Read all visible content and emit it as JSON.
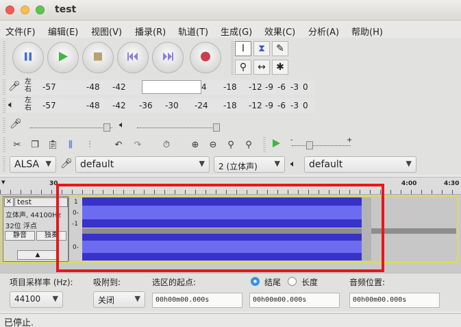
{
  "window": {
    "title": "test"
  },
  "menu": [
    "文件(F)",
    "编辑(E)",
    "视图(V)",
    "播录(R)",
    "轨道(T)",
    "生成(G)",
    "效果(C)",
    "分析(A)",
    "帮助(H)"
  ],
  "meters": {
    "record_channel_label": [
      "左",
      "右"
    ],
    "play_channel_label": [
      "左",
      "右"
    ],
    "record_ticks": [
      "-57",
      "-48",
      "-42",
      "4",
      "-18",
      "-12",
      "-9",
      "-6",
      "-3",
      "0"
    ],
    "play_ticks": [
      "-57",
      "-48",
      "-42",
      "-36",
      "-30",
      "-24",
      "-18",
      "-12",
      "-9",
      "-6",
      "-3",
      "0"
    ]
  },
  "mixer": {
    "record_level": 0.93,
    "play_level": 0.97,
    "speed_marks": [
      "-",
      "+"
    ]
  },
  "device": {
    "host": "ALSA",
    "record_device": "default",
    "channels": "2 (立体声)",
    "play_device": "default"
  },
  "timeline": {
    "ticks": [
      "30",
      "4:00",
      "4:30"
    ]
  },
  "track": {
    "name": "test",
    "info_line1": "立体声, 44100Hz",
    "info_line2": "32位 浮点",
    "mute_label": "静音",
    "solo_label": "独奏",
    "scale_ch1": [
      "1",
      "0-",
      "-1"
    ],
    "scale_ch2": [
      "0-"
    ],
    "waveform_color": "#3832c8",
    "rms_color": "#6c6cf0",
    "border_color": "#e0d860"
  },
  "annotation_color": "#e8161b",
  "selection": {
    "rate_label": "项目采样率 (Hz):",
    "rate_value": "44100",
    "snap_label": "吸附到:",
    "snap_value": "关闭",
    "start_label": "选区的起点:",
    "end_label": "结尾",
    "length_label": "长度",
    "start_value": "00h00m00.000s",
    "end_value": "00h00m00.000s",
    "audio_pos_label": "音频位置:",
    "audio_pos_value": "00h00m00.000s"
  },
  "status": {
    "text": "已停止."
  }
}
